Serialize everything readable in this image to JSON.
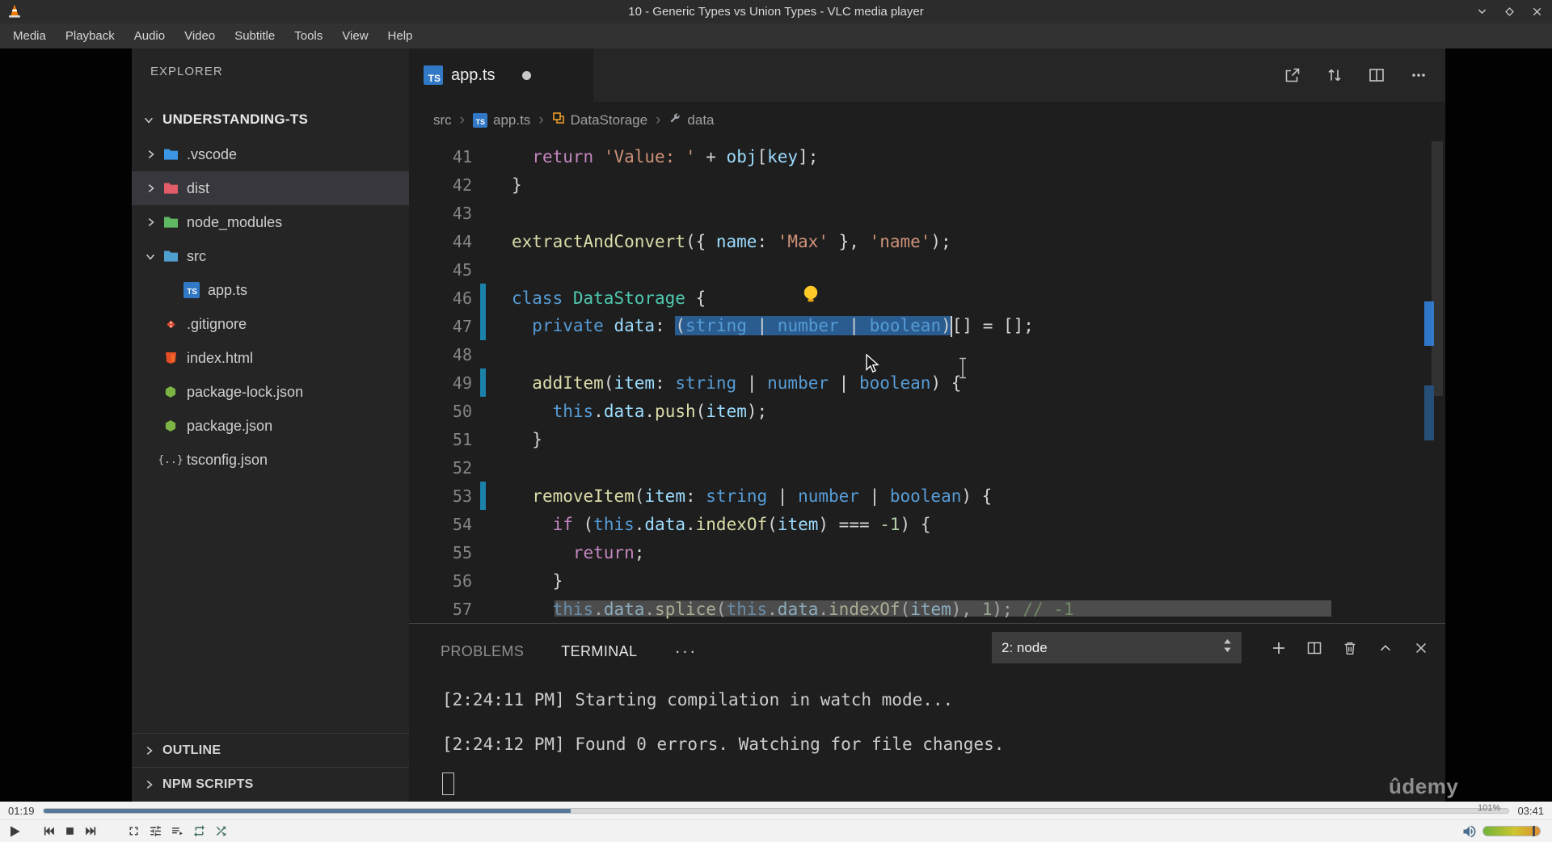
{
  "vlc": {
    "window_title": "10 - Generic Types vs Union Types - VLC media player",
    "menu": [
      "Media",
      "Playback",
      "Audio",
      "Video",
      "Subtitle",
      "Tools",
      "View",
      "Help"
    ],
    "window_controls": [
      "shade",
      "maximize",
      "close"
    ],
    "transport_controls": [
      "play",
      "previous",
      "stop",
      "next",
      "fullscreen",
      "extended-settings",
      "playlist",
      "loop",
      "random"
    ],
    "time_elapsed": "01:19",
    "time_total": "03:41",
    "progress_percent": 36,
    "volume_label": "101%"
  },
  "vscode": {
    "explorer": {
      "header": "EXPLORER",
      "root_label": "UNDERSTANDING-TS",
      "items": [
        {
          "label": ".vscode",
          "icon": "folder",
          "color": "#3b97e3",
          "chevron": "collapsed"
        },
        {
          "label": "dist",
          "icon": "folder",
          "color": "#e25d68",
          "chevron": "collapsed",
          "selected": true
        },
        {
          "label": "node_modules",
          "icon": "folder",
          "color": "#5fb862",
          "chevron": "collapsed"
        },
        {
          "label": "src",
          "icon": "folder",
          "color": "#4f9fcf",
          "chevron": "expanded"
        },
        {
          "label": "app.ts",
          "icon": "ts",
          "indent": 1
        },
        {
          "label": ".gitignore",
          "icon": "git"
        },
        {
          "label": "index.html",
          "icon": "html"
        },
        {
          "label": "package-lock.json",
          "icon": "npm"
        },
        {
          "label": "package.json",
          "icon": "npm"
        },
        {
          "label": "tsconfig.json",
          "icon": "braces"
        }
      ],
      "sections": [
        "OUTLINE",
        "NPM SCRIPTS"
      ]
    },
    "editor": {
      "tab_label": "app.ts",
      "tab_modified": true,
      "actions": [
        "open-changes",
        "compare-changes",
        "split-editor",
        "more-actions"
      ],
      "breadcrumb": [
        {
          "label": "src"
        },
        {
          "label": "app.ts",
          "icon": "ts"
        },
        {
          "label": "DataStorage",
          "icon": "class"
        },
        {
          "label": "data",
          "icon": "field"
        }
      ],
      "code_lines": [
        {
          "n": "41",
          "tokens": [
            {
              "c": "p",
              "t": "  "
            },
            {
              "c": "c",
              "t": "return"
            },
            {
              "c": "p",
              "t": " "
            },
            {
              "c": "s",
              "t": "'Value: '"
            },
            {
              "c": "p",
              "t": " + "
            },
            {
              "c": "v",
              "t": "obj"
            },
            {
              "c": "p",
              "t": "["
            },
            {
              "c": "v",
              "t": "key"
            },
            {
              "c": "p",
              "t": "];"
            }
          ]
        },
        {
          "n": "42",
          "tokens": [
            {
              "c": "p",
              "t": "}"
            }
          ]
        },
        {
          "n": "43",
          "tokens": []
        },
        {
          "n": "44",
          "tokens": [
            {
              "c": "f",
              "t": "extractAndConvert"
            },
            {
              "c": "p",
              "t": "({ "
            },
            {
              "c": "v",
              "t": "name"
            },
            {
              "c": "p",
              "t": ": "
            },
            {
              "c": "s",
              "t": "'Max'"
            },
            {
              "c": "p",
              "t": " }, "
            },
            {
              "c": "s",
              "t": "'name'"
            },
            {
              "c": "p",
              "t": ");"
            }
          ]
        },
        {
          "n": "45",
          "tokens": []
        },
        {
          "n": "46",
          "mod": true,
          "tokens": [
            {
              "c": "k",
              "t": "class"
            },
            {
              "c": "p",
              "t": " "
            },
            {
              "c": "t",
              "t": "DataStorage"
            },
            {
              "c": "p",
              "t": " {"
            }
          ]
        },
        {
          "n": "47",
          "mod": true,
          "tokens": [
            {
              "c": "p",
              "t": "  "
            },
            {
              "c": "k",
              "t": "private"
            },
            {
              "c": "p",
              "t": " "
            },
            {
              "c": "v",
              "t": "data"
            },
            {
              "c": "p",
              "t": ": "
            },
            {
              "c": "p",
              "t": "(",
              "sel": true
            },
            {
              "c": "k",
              "t": "string",
              "sel": true
            },
            {
              "c": "p",
              "t": " | ",
              "sel": true
            },
            {
              "c": "k",
              "t": "number",
              "sel": true
            },
            {
              "c": "p",
              "t": " | ",
              "sel": true
            },
            {
              "c": "k",
              "t": "boolean",
              "sel": true
            },
            {
              "c": "p",
              "t": ")",
              "sel": true
            },
            {
              "caret": true
            },
            {
              "c": "p",
              "t": "[] = [];"
            }
          ]
        },
        {
          "n": "48",
          "tokens": []
        },
        {
          "n": "49",
          "mod": true,
          "tokens": [
            {
              "c": "p",
              "t": "  "
            },
            {
              "c": "f",
              "t": "addItem"
            },
            {
              "c": "p",
              "t": "("
            },
            {
              "c": "v",
              "t": "item"
            },
            {
              "c": "p",
              "t": ": "
            },
            {
              "c": "k",
              "t": "string"
            },
            {
              "c": "p",
              "t": " | "
            },
            {
              "c": "k",
              "t": "number"
            },
            {
              "c": "p",
              "t": " | "
            },
            {
              "c": "k",
              "t": "boolean"
            },
            {
              "c": "p",
              "t": ") {"
            }
          ]
        },
        {
          "n": "50",
          "tokens": [
            {
              "c": "p",
              "t": "    "
            },
            {
              "c": "k",
              "t": "this"
            },
            {
              "c": "p",
              "t": "."
            },
            {
              "c": "v",
              "t": "data"
            },
            {
              "c": "p",
              "t": "."
            },
            {
              "c": "f",
              "t": "push"
            },
            {
              "c": "p",
              "t": "("
            },
            {
              "c": "v",
              "t": "item"
            },
            {
              "c": "p",
              "t": ");"
            }
          ]
        },
        {
          "n": "51",
          "tokens": [
            {
              "c": "p",
              "t": "  }"
            }
          ]
        },
        {
          "n": "52",
          "tokens": []
        },
        {
          "n": "53",
          "mod": true,
          "tokens": [
            {
              "c": "p",
              "t": "  "
            },
            {
              "c": "f",
              "t": "removeItem"
            },
            {
              "c": "p",
              "t": "("
            },
            {
              "c": "v",
              "t": "item"
            },
            {
              "c": "p",
              "t": ": "
            },
            {
              "c": "k",
              "t": "string"
            },
            {
              "c": "p",
              "t": " | "
            },
            {
              "c": "k",
              "t": "number"
            },
            {
              "c": "p",
              "t": " | "
            },
            {
              "c": "k",
              "t": "boolean"
            },
            {
              "c": "p",
              "t": ") {"
            }
          ]
        },
        {
          "n": "54",
          "tokens": [
            {
              "c": "p",
              "t": "    "
            },
            {
              "c": "c",
              "t": "if"
            },
            {
              "c": "p",
              "t": " ("
            },
            {
              "c": "k",
              "t": "this"
            },
            {
              "c": "p",
              "t": "."
            },
            {
              "c": "v",
              "t": "data"
            },
            {
              "c": "p",
              "t": "."
            },
            {
              "c": "f",
              "t": "indexOf"
            },
            {
              "c": "p",
              "t": "("
            },
            {
              "c": "v",
              "t": "item"
            },
            {
              "c": "p",
              "t": ") === "
            },
            {
              "c": "n",
              "t": "-1"
            },
            {
              "c": "p",
              "t": ") {"
            }
          ]
        },
        {
          "n": "55",
          "tokens": [
            {
              "c": "p",
              "t": "      "
            },
            {
              "c": "c",
              "t": "return"
            },
            {
              "c": "p",
              "t": ";"
            }
          ]
        },
        {
          "n": "56",
          "tokens": [
            {
              "c": "p",
              "t": "    }"
            }
          ]
        },
        {
          "n": "57",
          "tokens": [
            {
              "c": "p",
              "t": "    "
            },
            {
              "c": "k",
              "t": "this"
            },
            {
              "c": "p",
              "t": "."
            },
            {
              "c": "v",
              "t": "data"
            },
            {
              "c": "p",
              "t": "."
            },
            {
              "c": "f",
              "t": "splice"
            },
            {
              "c": "p",
              "t": "("
            },
            {
              "c": "k",
              "t": "this"
            },
            {
              "c": "p",
              "t": "."
            },
            {
              "c": "v",
              "t": "data"
            },
            {
              "c": "p",
              "t": "."
            },
            {
              "c": "f",
              "t": "indexOf"
            },
            {
              "c": "p",
              "t": "("
            },
            {
              "c": "v",
              "t": "item"
            },
            {
              "c": "p",
              "t": "), "
            },
            {
              "c": "n",
              "t": "1"
            },
            {
              "c": "p",
              "t": "); "
            },
            {
              "c": "cm",
              "t": "// -1"
            }
          ]
        }
      ]
    },
    "panel": {
      "tabs": [
        {
          "label": "PROBLEMS",
          "active": false
        },
        {
          "label": "TERMINAL",
          "active": true
        }
      ],
      "shell_select": "2: node",
      "actions": [
        "new-terminal",
        "split-terminal",
        "kill-terminal",
        "maximize-panel",
        "close-panel"
      ],
      "output": [
        "[2:24:11 PM] Starting compilation in watch mode...",
        "[2:24:12 PM] Found 0 errors. Watching for file changes."
      ]
    },
    "watermark": "ûdemy"
  },
  "colors": {
    "selection": "#264f78",
    "modified_gutter": "#1b81a8",
    "seek_progress": "#55789b",
    "keyword_blue": "#569cd6",
    "class_teal": "#4ec9b0"
  }
}
